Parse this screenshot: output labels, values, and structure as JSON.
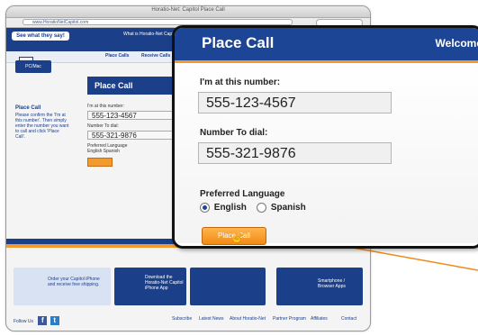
{
  "browser": {
    "window_title": "Horatio-Net: Capitol Place Call",
    "url": "www.HoratioNetCapitol.com"
  },
  "background_page": {
    "tagline": "See what they say!",
    "nav_text": "What is Horatio-Net Capitol?",
    "subnav": [
      "Place Calls",
      "Receive Calls"
    ],
    "side_tab": "PC/Mac",
    "panel_title": "Place Call",
    "left_heading": "Place Call",
    "left_text": "Please confirm the 'I'm at this number'. Then simply enter the number you want to call and click 'Place Call'.",
    "form": {
      "label_at": "I'm at this number:",
      "value_at": "555-123-4567",
      "label_dial": "Number To dial:",
      "value_dial": "555-321-9876",
      "label_lang": "Preferred Language",
      "lang_options": [
        "English",
        "Spanish"
      ]
    },
    "promos": [
      "Order your Capitol iPhone and receive free shipping.",
      "Download the Horatio-Net Capitol iPhone App",
      "Smartphone / Browser Apps"
    ],
    "footer_follow": "Follow Us",
    "footer_links": [
      "Subscribe",
      "Latest News",
      "About Horatio-Net",
      "Partner Program",
      "Affiliates",
      "Contact"
    ]
  },
  "zoom": {
    "title": "Place Call",
    "welcome": "Welcome",
    "label_at": "I'm at this number:",
    "value_at": "555-123-4567",
    "label_dial": "Number To dial:",
    "value_dial": "555-321-9876",
    "label_lang": "Preferred Language",
    "lang_english": "English",
    "lang_spanish": "Spanish",
    "place_button": "Place Call"
  },
  "colors": {
    "brand_blue": "#1c4596",
    "accent_orange": "#f39a2e",
    "leader_lines": "#f08a14"
  }
}
